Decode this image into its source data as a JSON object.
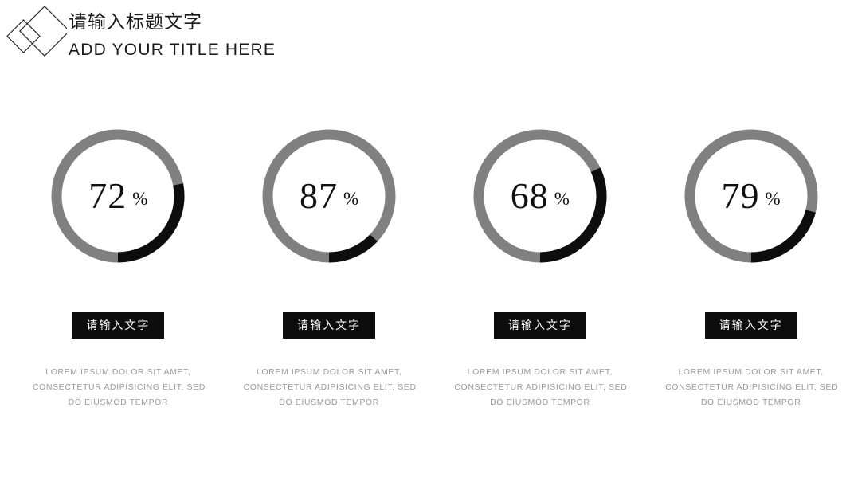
{
  "header": {
    "logo_icon": "double-diamond-icon",
    "title_cn": "请输入标题文字",
    "title_en": "ADD YOUR TITLE HERE"
  },
  "theme": {
    "track_color": "#808080",
    "arc_color": "#0d0d0d",
    "button_bg": "#0d0d0d",
    "button_text": "#ffffff",
    "body_text_color": "#9a9a9a",
    "title_color": "#1a1a1a"
  },
  "chart_data": {
    "type": "pie",
    "title": "请输入标题文字 / ADD YOUR TITLE HERE",
    "subtype": "donut-progress",
    "unit": "%",
    "categories": [
      "请输入文字",
      "请输入文字",
      "请输入文字",
      "请输入文字"
    ],
    "values": [
      72,
      87,
      68,
      79
    ],
    "series": [
      {
        "name": "filled",
        "values": [
          72,
          87,
          68,
          79
        ],
        "color": "#808080"
      },
      {
        "name": "remainder",
        "values": [
          28,
          13,
          32,
          21
        ],
        "color": "#0d0d0d"
      }
    ],
    "legend": false,
    "grid": false,
    "ylim": [
      0,
      100
    ]
  },
  "columns": [
    {
      "value": "72",
      "sign": "%",
      "filled": 72,
      "remainder": 28,
      "label": "请输入文字",
      "desc_line1": "LOREM IPSUM DOLOR SIT AMET,",
      "desc_line2": "CONSECTETUR ADIPISICING ELIT, SED",
      "desc_line3": "DO EIUSMOD TEMPOR"
    },
    {
      "value": "87",
      "sign": "%",
      "filled": 87,
      "remainder": 13,
      "label": "请输入文字",
      "desc_line1": "LOREM IPSUM DOLOR SIT AMET,",
      "desc_line2": "CONSECTETUR ADIPISICING ELIT, SED",
      "desc_line3": "DO EIUSMOD TEMPOR"
    },
    {
      "value": "68",
      "sign": "%",
      "filled": 68,
      "remainder": 32,
      "label": "请输入文字",
      "desc_line1": "LOREM IPSUM DOLOR SIT AMET,",
      "desc_line2": "CONSECTETUR ADIPISICING ELIT, SED",
      "desc_line3": "DO EIUSMOD TEMPOR"
    },
    {
      "value": "79",
      "sign": "%",
      "filled": 79,
      "remainder": 21,
      "label": "请输入文字",
      "desc_line1": "LOREM IPSUM DOLOR SIT AMET,",
      "desc_line2": "CONSECTETUR ADIPISICING ELIT, SED",
      "desc_line3": "DO EIUSMOD TEMPOR"
    }
  ]
}
